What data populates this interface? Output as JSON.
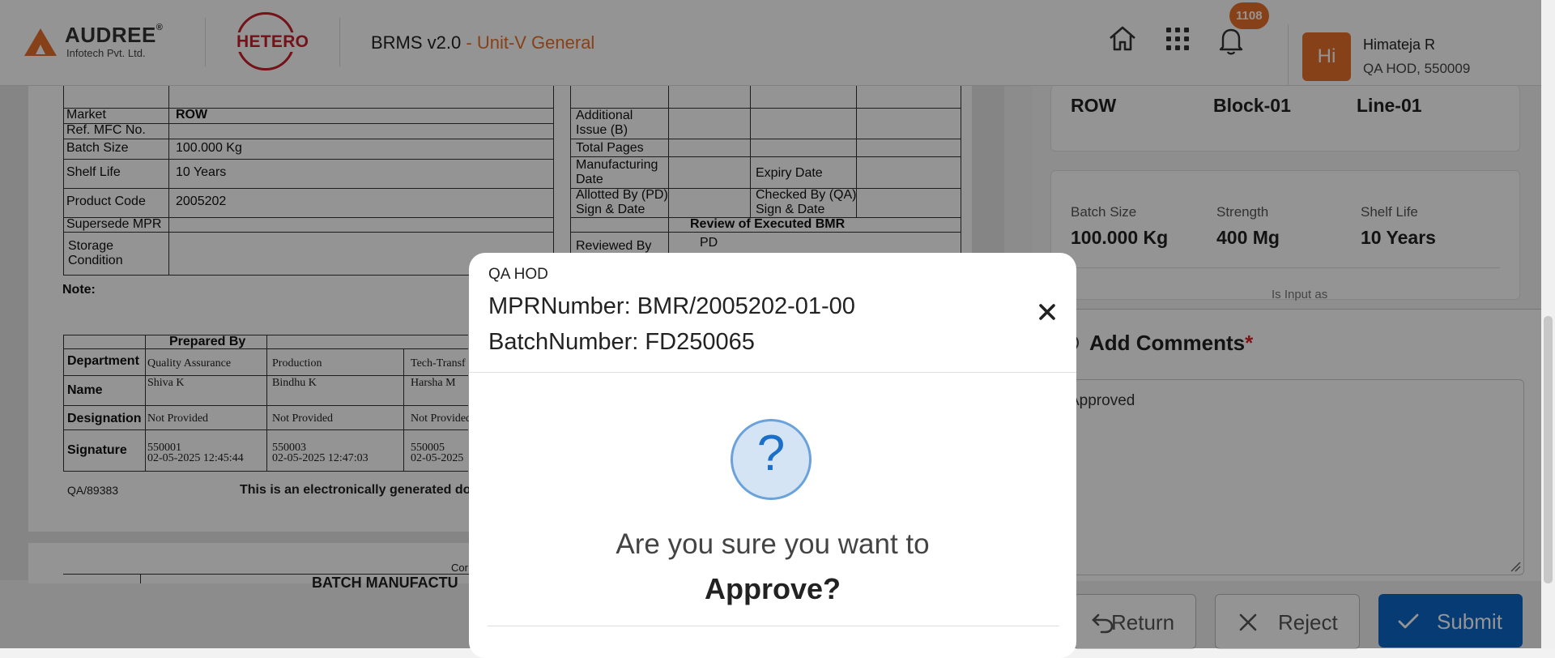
{
  "header": {
    "logo_brand": "AUDREE",
    "logo_sub": "Infotech Pvt. Ltd.",
    "client_logo": "HETERO",
    "app_name": "BRMS v2.0",
    "unit": " - Unit-V General",
    "notification_count": "1108",
    "avatar_initials": "Hi",
    "user_name": "Himateja R",
    "user_role": "QA HOD, 550009",
    "icons": [
      "home-icon",
      "apps-grid-icon",
      "bell-icon"
    ]
  },
  "document": {
    "left_rows": [
      {
        "label": "Market",
        "value": "ROW"
      },
      {
        "label": "Ref. MFC No.",
        "value": ""
      },
      {
        "label": "Batch Size",
        "value": "100.000 Kg"
      },
      {
        "label": "Shelf Life",
        "value": "10 Years"
      },
      {
        "label": "Product Code",
        "value": "2005202"
      },
      {
        "label": "Supersede MPR",
        "value": ""
      },
      {
        "label": "Storage\nCondition",
        "value": ""
      }
    ],
    "right_rows": {
      "additional_issue": "Additional\nIssue (B)",
      "total_pages": "Total Pages",
      "mfg_date": "Manufacturing\nDate",
      "expiry_date": "Expiry Date",
      "allotted_by": "Allotted By (PD)\nSign & Date",
      "checked_by": "Checked By (QA)\nSign & Date",
      "review_header": "Review of Executed BMR",
      "reviewed_by": "Reviewed By",
      "pd": "PD"
    },
    "note": "Note:",
    "prepared_by": "Prepared By",
    "sig_rows": {
      "department": "Department",
      "name": "Name",
      "designation": "Designation",
      "signature": "Signature"
    },
    "sig_cols": [
      {
        "department": "Quality Assurance",
        "name": "Shiva  K",
        "designation": "Not Provided",
        "sig1": "550001",
        "sig2": "02-05-2025 12:45:44"
      },
      {
        "department": "Production",
        "name": "Bindhu  K",
        "designation": "Not Provided",
        "sig1": "550003",
        "sig2": "02-05-2025 12:47:03"
      },
      {
        "department": "Tech-Transf",
        "name": "Harsha  M",
        "designation": "Not Provided",
        "sig1": "550005",
        "sig2": "02-05-2025"
      }
    ],
    "footer_code": "QA/89383",
    "footer_text": "This is an electronically generated doc",
    "page2_small": "Cor",
    "page2_title": "BATCH MANUFACTU"
  },
  "right_panel": {
    "row1": [
      "ROW",
      "Block-01",
      "Line-01"
    ],
    "row2_labels": [
      "Batch Size",
      "Strength",
      "Shelf Life"
    ],
    "row2_values": [
      "100.000 Kg",
      "400 Mg",
      "10 Years"
    ],
    "partial_label": "Is Input as",
    "comments_label": "Add Comments",
    "required_mark": "*",
    "comment_text": "Approved",
    "buttons": {
      "return": "Return",
      "reject": "Reject",
      "submit": "Submit"
    }
  },
  "modal": {
    "role": "QA HOD",
    "mpr": "MPRNumber: BMR/2005202-01-00",
    "batch": "BatchNumber: FD250065",
    "question_line1": "Are you sure you want to",
    "question_line2": "Approve?",
    "icon": "question-icon"
  }
}
